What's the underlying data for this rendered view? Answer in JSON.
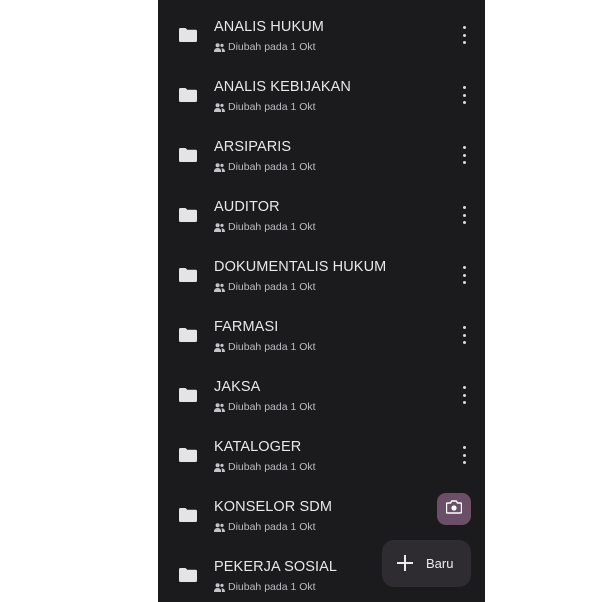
{
  "files": [
    {
      "name": "ANALIS HUKUM",
      "meta": "Diubah pada 1 Okt",
      "icon": "folder-icon"
    },
    {
      "name": "ANALIS KEBIJAKAN",
      "meta": "Diubah pada 1 Okt",
      "icon": "folder-icon"
    },
    {
      "name": "ARSIPARIS",
      "meta": "Diubah pada 1 Okt",
      "icon": "folder-icon"
    },
    {
      "name": "AUDITOR",
      "meta": "Diubah pada 1 Okt",
      "icon": "folder-icon"
    },
    {
      "name": "DOKUMENTALIS HUKUM",
      "meta": "Diubah pada 1 Okt",
      "icon": "folder-icon"
    },
    {
      "name": "FARMASI",
      "meta": "Diubah pada 1 Okt",
      "icon": "folder-icon"
    },
    {
      "name": "JAKSA",
      "meta": "Diubah pada 1 Okt",
      "icon": "folder-icon"
    },
    {
      "name": "KATALOGER",
      "meta": "Diubah pada 1 Okt",
      "icon": "folder-icon"
    },
    {
      "name": "KONSELOR SDM",
      "meta": "Diubah pada 1 Okt",
      "icon": "folder-icon"
    },
    {
      "name": "PEKERJA SOSIAL",
      "meta": "Diubah pada 1 Okt",
      "icon": "folder-icon"
    }
  ],
  "fab": {
    "new_label": "Baru",
    "new_icon": "plus-icon",
    "camera_icon": "camera-icon"
  },
  "colors": {
    "background": "#1b1b1d",
    "text_primary": "#e8e8ea",
    "text_secondary": "#bdbdc1",
    "camera_fab": "#6a4f66",
    "new_fab": "#2e2c31"
  }
}
